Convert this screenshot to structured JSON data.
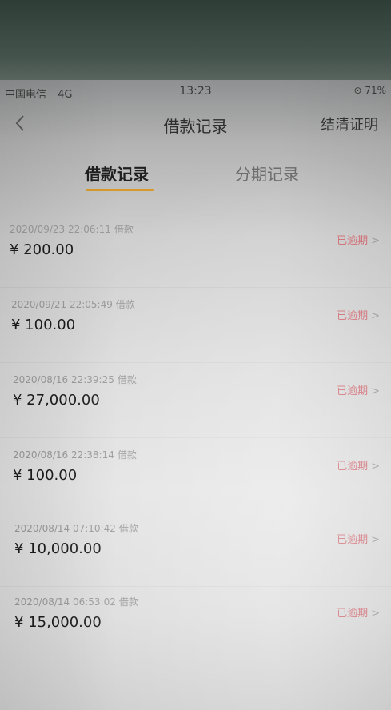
{
  "status_bar": {
    "carrier": "中国电信",
    "network": "4G",
    "time": "13:23",
    "battery": "71%"
  },
  "nav": {
    "back_icon": "chevron-left-icon",
    "title": "借款记录",
    "action_label": "结清证明"
  },
  "tabs": [
    {
      "label": "借款记录",
      "active": true
    },
    {
      "label": "分期记录",
      "active": false
    }
  ],
  "colors": {
    "accent": "#d79a28",
    "overdue": "#d56a72"
  },
  "records": [
    {
      "datetime": "2020/09/23 22:06:11",
      "type": "借款",
      "amount": "¥ 200.00",
      "status": "已逾期"
    },
    {
      "datetime": "2020/09/21 22:05:49",
      "type": "借款",
      "amount": "¥ 100.00",
      "status": "已逾期"
    },
    {
      "datetime": "2020/08/16 22:39:25",
      "type": "借款",
      "amount": "¥ 27,000.00",
      "status": "已逾期"
    },
    {
      "datetime": "2020/08/16 22:38:14",
      "type": "借款",
      "amount": "¥ 100.00",
      "status": "已逾期"
    },
    {
      "datetime": "2020/08/14 07:10:42",
      "type": "借款",
      "amount": "¥ 10,000.00",
      "status": "已逾期"
    },
    {
      "datetime": "2020/08/14 06:53:02",
      "type": "借款",
      "amount": "¥ 15,000.00",
      "status": "已逾期"
    }
  ]
}
